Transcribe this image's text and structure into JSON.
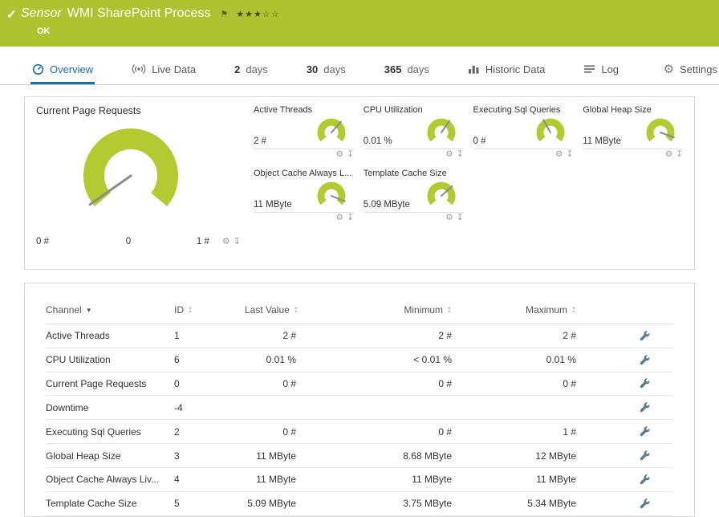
{
  "colors": {
    "green": "#aec32f",
    "blue": "#1b6fa8",
    "gauge": "#b4ca31"
  },
  "header": {
    "sensor_label": "Sensor",
    "title": "WMI SharePoint Process",
    "status": "OK",
    "stars": "★★★☆☆",
    "flag": "⚑",
    "check": "✓"
  },
  "tabs": {
    "overview": "Overview",
    "live_data": "Live Data",
    "d2_num": "2",
    "d2_label": "days",
    "d30_num": "30",
    "d30_label": "days",
    "d365_num": "365",
    "d365_label": "days",
    "historic": "Historic Data",
    "log": "Log",
    "settings": "Settings"
  },
  "gauges": {
    "main": {
      "title": "Current Page Requests",
      "min_label": "0 #",
      "current_label": "0",
      "max_label": "1 #",
      "needle_deg": -125
    },
    "small": [
      {
        "title": "Active Threads",
        "value": "2 #",
        "needle_deg": 42
      },
      {
        "title": "CPU Utilization",
        "value": "0.01 %",
        "needle_deg": 35
      },
      {
        "title": "Executing Sql Queries",
        "value": "0 #",
        "needle_deg": -30
      },
      {
        "title": "Global Heap Size",
        "value": "11 MByte",
        "needle_deg": 110
      },
      {
        "title": "Object Cache Always L...",
        "value": "11 MByte",
        "needle_deg": 112
      },
      {
        "title": "Template Cache Size",
        "value": "5.09 MByte",
        "needle_deg": 48
      }
    ],
    "icons": {
      "gear": "⚙",
      "download": "↧"
    }
  },
  "table": {
    "columns": [
      "Channel",
      "ID",
      "Last Value",
      "Minimum",
      "Maximum"
    ],
    "rows": [
      {
        "channel": "Active Threads",
        "id": "1",
        "last": "2 #",
        "min": "2 #",
        "max": "2 #"
      },
      {
        "channel": "CPU Utilization",
        "id": "6",
        "last": "0.01 %",
        "min": "< 0.01 %",
        "max": "0.01 %"
      },
      {
        "channel": "Current Page Requests",
        "id": "0",
        "last": "0 #",
        "min": "0 #",
        "max": "0 #"
      },
      {
        "channel": "Downtime",
        "id": "-4",
        "last": "",
        "min": "",
        "max": ""
      },
      {
        "channel": "Executing Sql Queries",
        "id": "2",
        "last": "0 #",
        "min": "0 #",
        "max": "1 #"
      },
      {
        "channel": "Global Heap Size",
        "id": "3",
        "last": "11 MByte",
        "min": "8.68 MByte",
        "max": "12 MByte"
      },
      {
        "channel": "Object Cache Always Liv...",
        "id": "4",
        "last": "11 MByte",
        "min": "11 MByte",
        "max": "11 MByte"
      },
      {
        "channel": "Template Cache Size",
        "id": "5",
        "last": "5.09 MByte",
        "min": "3.75 MByte",
        "max": "5.34 MByte"
      }
    ]
  }
}
